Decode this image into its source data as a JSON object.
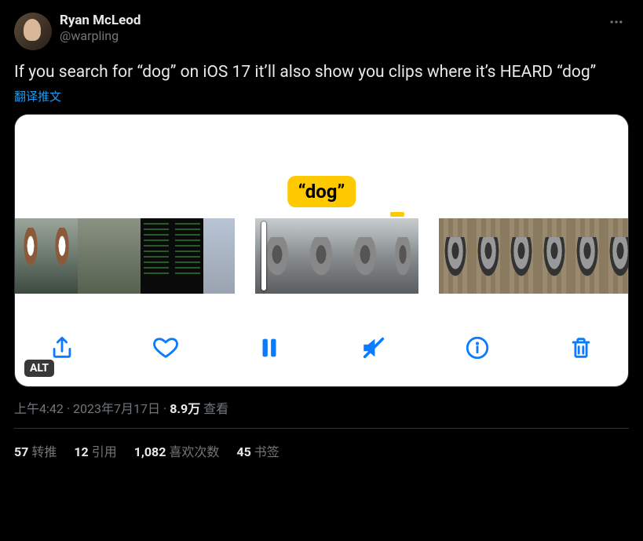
{
  "author": {
    "display_name": "Ryan McLeod",
    "handle": "@warpling"
  },
  "content_text": "If you search for “dog” on iOS 17 it’ll also show you clips where it’s HEARD “dog”",
  "translate_label": "翻译推文",
  "media": {
    "caption": "“dog”",
    "alt_badge": "ALT",
    "toolbar": {
      "share": "share",
      "like": "like",
      "pause": "pause",
      "mute": "mute",
      "info": "info",
      "trash": "trash"
    }
  },
  "meta": {
    "time": "上午4:42",
    "date": "2023年7月17日",
    "views_count": "8.9万",
    "views_label": "查看"
  },
  "stats": {
    "retweets_count": "57",
    "retweets_label": "转推",
    "quotes_count": "12",
    "quotes_label": "引用",
    "likes_count": "1,082",
    "likes_label": "喜欢次数",
    "bookmarks_count": "45",
    "bookmarks_label": "书签"
  }
}
